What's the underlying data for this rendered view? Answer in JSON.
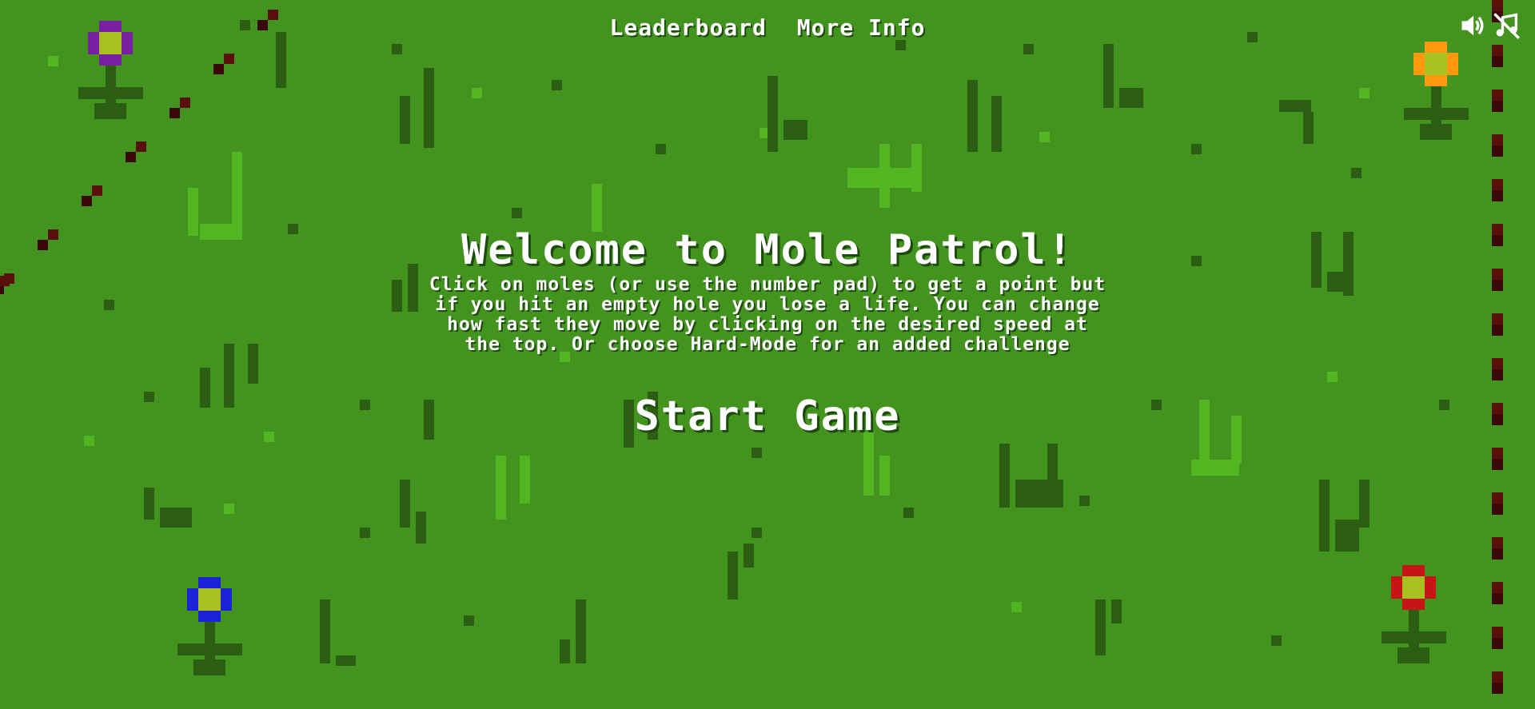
{
  "nav": {
    "leaderboard_label": "Leaderboard",
    "more_info_label": "More Info"
  },
  "audio": {
    "sound_icon": "speaker-volume-icon",
    "music_icon": "music-muted-icon"
  },
  "welcome": {
    "title": "Welcome to Mole Patrol!",
    "description": "Click on moles (or use the number pad) to get a point but if you hit an empty hole you lose a life. You can change how fast they move by clicking on the desired speed at the top. Or choose Hard-Mode for an added challenge",
    "start_label": "Start Game"
  },
  "colors": {
    "grass": "#43931f",
    "grass_dark": "#2b5e12",
    "grass_light": "#52b522",
    "fence": "#5a0f0a",
    "flower_purple": "#7a1fa0",
    "flower_orange": "#ff9a10",
    "flower_blue": "#1a24d6",
    "flower_red": "#c81414",
    "flower_center": "#a8c020"
  }
}
